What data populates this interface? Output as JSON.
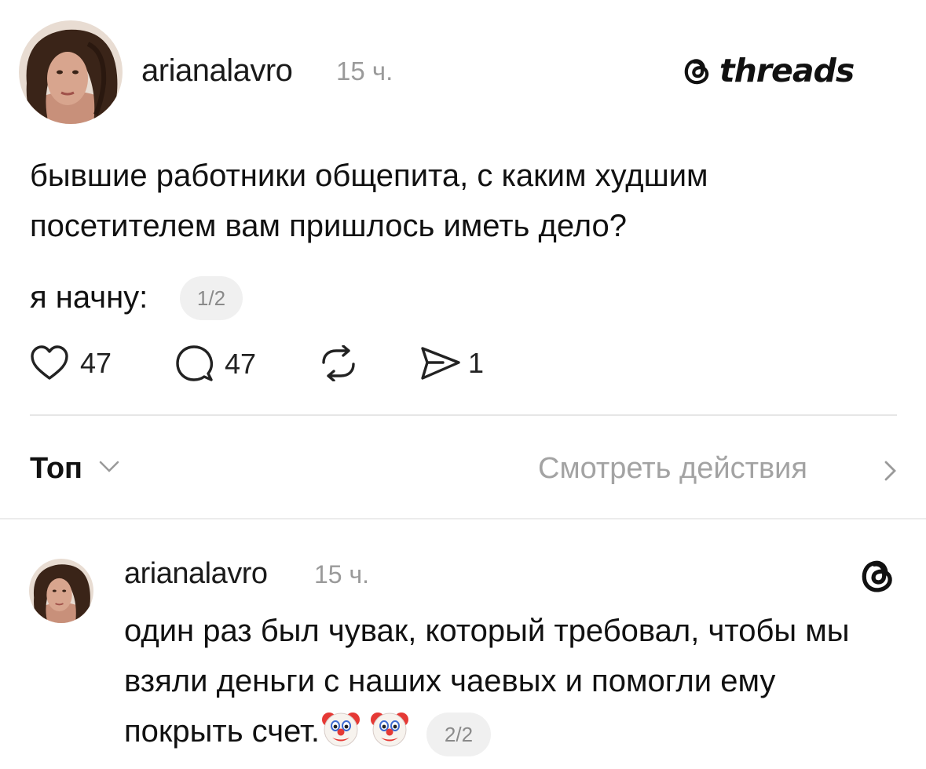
{
  "post": {
    "username": "arianalavro",
    "time": "15 ч.",
    "brand": "threads",
    "text": "бывшие работники общепита, с каким худшим посетителем вам пришлось иметь дело?",
    "text_continued": "я начну:",
    "pager": "1/2",
    "actions": {
      "likes": "47",
      "comments": "47",
      "shares": "1"
    }
  },
  "replies_bar": {
    "sort_label": "Топ",
    "activity_label": "Смотреть действия"
  },
  "reply": {
    "username": "arianalavro",
    "time": "15 ч.",
    "text": "один раз был чувак, который требовал, чтобы мы взяли деньги с наших чаевых и помогли ему покрыть счет.",
    "emojis": [
      "clown-face",
      "clown-face"
    ],
    "pager": "2/2"
  },
  "icons": {
    "heart": "heart-icon",
    "comment": "comment-icon",
    "repost": "repost-icon",
    "share": "send-icon",
    "threads": "threads-logo-icon"
  }
}
